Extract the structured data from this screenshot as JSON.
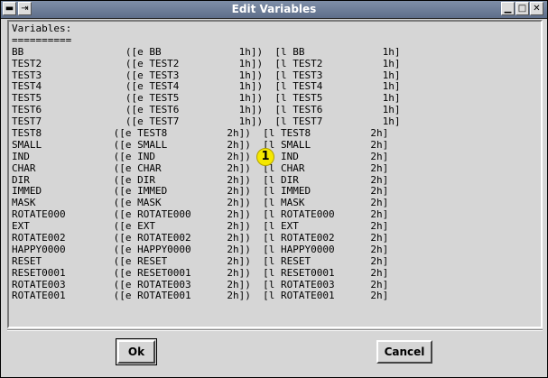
{
  "window": {
    "title": "Edit Variables"
  },
  "titlebar_icons": {
    "left": "pin-icon",
    "left2": "collapse-icon",
    "right1": "minimize-icon",
    "right2": "maximize-icon",
    "right3": "close-icon"
  },
  "content": {
    "header": "Variables:",
    "divider": "==========",
    "lines": [
      "BB                 ([e BB             1h])  [l BB             1h]",
      "TEST2              ([e TEST2          1h])  [l TEST2          1h]",
      "TEST3              ([e TEST3          1h])  [l TEST3          1h]",
      "TEST4              ([e TEST4          1h])  [l TEST4          1h]",
      "TEST5              ([e TEST5          1h])  [l TEST5          1h]",
      "TEST6              ([e TEST6          1h])  [l TEST6          1h]",
      "TEST7              ([e TEST7          1h])  [l TEST7          1h]",
      "TEST8            ([e TEST8          2h])  [l TEST8          2h]",
      "SMALL            ([e SMALL          2h])  [l SMALL          2h]",
      "IND              ([e IND            2h])  [l IND            2h]",
      "CHAR             ([e CHAR           2h])  [l CHAR           2h]",
      "DIR              ([e DIR            2h])  [l DIR            2h]",
      "IMMED            ([e IMMED          2h])  [l IMMED          2h]",
      "MASK             ([e MASK           2h])  [l MASK           2h]",
      "ROTATE000        ([e ROTATE000      2h])  [l ROTATE000      2h]",
      "EXT              ([e EXT            2h])  [l EXT            2h]",
      "ROTATE002        ([e ROTATE002      2h])  [l ROTATE002      2h]",
      "HAPPY0000        ([e HAPPY0000      2h])  [l HAPPY0000      2h]",
      "RESET            ([e RESET          2h])  [l RESET          2h]",
      "RESET0001        ([e RESET0001      2h])  [l RESET0001      2h]",
      "ROTATE003        ([e ROTATE003      2h])  [l ROTATE003      2h]",
      "ROTATE001        ([e ROTATE001      2h])  [l ROTATE001      2h]"
    ]
  },
  "marker": {
    "label": "1",
    "color": "#f5e800"
  },
  "buttons": {
    "ok": "Ok",
    "cancel": "Cancel"
  }
}
